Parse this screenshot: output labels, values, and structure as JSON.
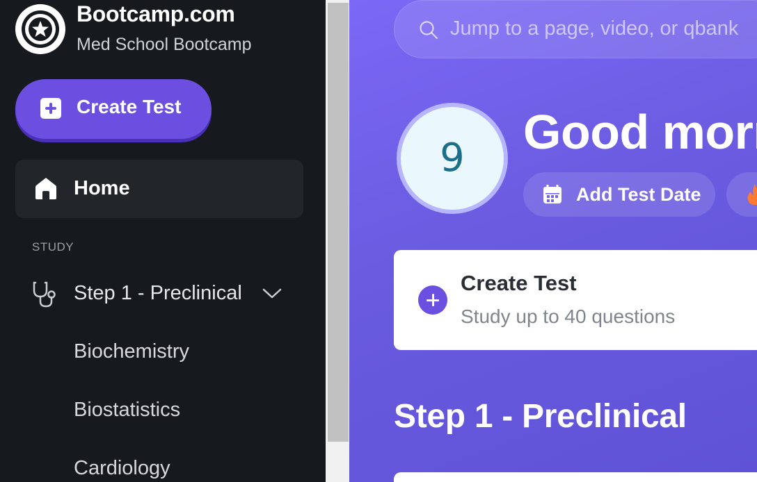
{
  "brand": {
    "title": "Bootcamp.com",
    "subtitle": "Med School Bootcamp"
  },
  "sidebar": {
    "create_label": "Create Test",
    "home_label": "Home",
    "section_label": "STUDY",
    "step_label": "Step 1 - Preclinical",
    "sub_items": [
      {
        "label": "Biochemistry"
      },
      {
        "label": "Biostatistics"
      },
      {
        "label": "Cardiology"
      }
    ]
  },
  "search": {
    "placeholder": "Jump to a page, video, or qbank"
  },
  "header": {
    "avatar_number": "9",
    "greeting": "Good morning",
    "add_date_label": "Add Test Date"
  },
  "card": {
    "title": "Create Test",
    "subtitle": "Study up to 40 questions"
  },
  "main": {
    "section_title": "Step 1 - Preclinical"
  },
  "colors": {
    "accent": "#6c4fe0",
    "sidebar_bg": "#16191d",
    "streak": "#ff7a2e"
  }
}
